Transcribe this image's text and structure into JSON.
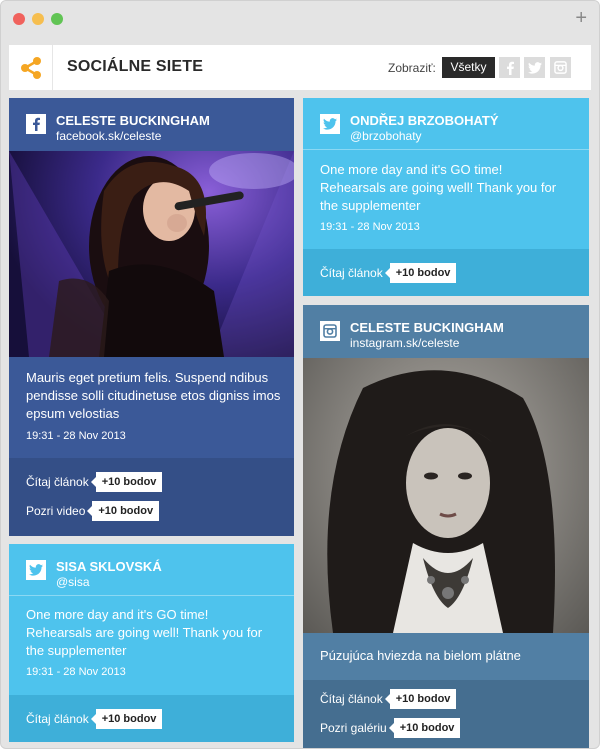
{
  "header": {
    "title": "SOCIÁLNE SIETE",
    "show_label": "Zobraziť:",
    "filter_all": "Všetky",
    "filter_icons": [
      "facebook-icon",
      "twitter-icon",
      "instagram-icon"
    ]
  },
  "colors": {
    "accent": "#f5a623",
    "facebook": "#3b5998",
    "twitter": "#4ec3ed",
    "instagram": "#517fa4"
  },
  "cards": {
    "facebook": {
      "network_icon": "facebook-icon",
      "name": "CELESTE BUCKINGHAM",
      "handle": "facebook.sk/celeste",
      "text": "Mauris eget pretium felis. Suspend ndibus pendisse solli citudinetuse etos digniss imos epsum velostias",
      "time": "19:31 - 28 Nov 2013",
      "actions": [
        {
          "label": "Čítaj článok",
          "badge": "+10 bodov"
        },
        {
          "label": "Pozri video",
          "badge": "+10 bodov"
        }
      ]
    },
    "twitter1": {
      "network_icon": "twitter-icon",
      "name": "ONDŘEJ BRZOBOHATÝ",
      "handle": "@brzobohaty",
      "text": "One more day and it's GO time! Rehearsals are going well! Thank you for the supplementer",
      "time": "19:31 - 28 Nov 2013",
      "actions": [
        {
          "label": "Čítaj článok",
          "badge": "+10 bodov"
        }
      ]
    },
    "instagram": {
      "network_icon": "instagram-icon",
      "name": "CELESTE BUCKINGHAM",
      "handle": "instagram.sk/celeste",
      "text": "Púzujúca hviezda na bielom plátne",
      "actions": [
        {
          "label": "Čítaj článok",
          "badge": "+10 bodov"
        },
        {
          "label": "Pozri galériu",
          "badge": "+10 bodov"
        }
      ]
    },
    "twitter2": {
      "network_icon": "twitter-icon",
      "name": "SISA SKLOVSKÁ",
      "handle": "@sisa",
      "text": "One more day and it's GO time! Rehearsals are going well! Thank you for the supplementer",
      "time": "19:31 - 28 Nov 2013",
      "actions": [
        {
          "label": "Čítaj článok",
          "badge": "+10 bodov"
        }
      ]
    }
  }
}
